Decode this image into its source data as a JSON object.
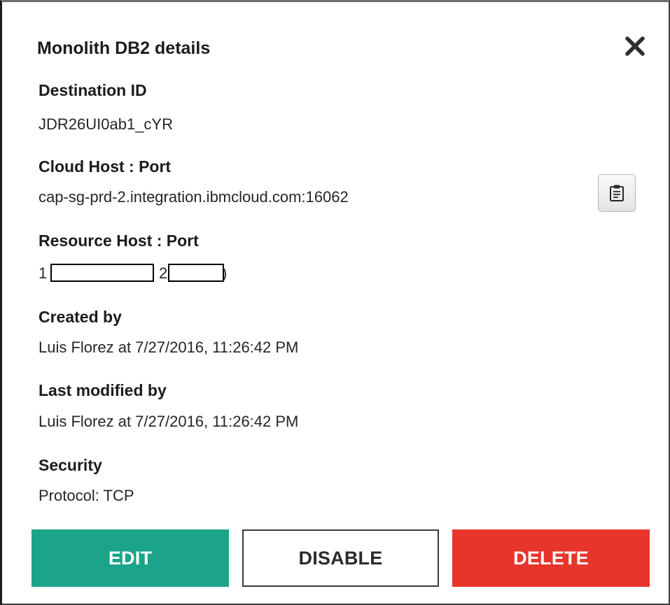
{
  "dialog": {
    "title": "Monolith DB2 details",
    "close_icon": "close-icon"
  },
  "sections": {
    "destination_id": {
      "label": "Destination ID",
      "value": "JDR26UI0ab1_cYR"
    },
    "cloud_host": {
      "label": "Cloud Host : Port",
      "value": "cap-sg-prd-2.integration.ibmcloud.com:16062",
      "copy_icon": "clipboard-icon"
    },
    "resource_host": {
      "label": "Resource Host : Port",
      "visible_fragments": [
        "1",
        "2",
        ")"
      ]
    },
    "created_by": {
      "label": "Created by",
      "value": "Luis Florez at 7/27/2016, 11:26:42 PM"
    },
    "last_modified_by": {
      "label": "Last modified by",
      "value": "Luis Florez at 7/27/2016, 11:26:42 PM"
    },
    "security": {
      "label": "Security",
      "value": "Protocol: TCP"
    }
  },
  "actions": {
    "edit_label": "EDIT",
    "disable_label": "DISABLE",
    "delete_label": "DELETE"
  },
  "colors": {
    "edit": "#1ba48a",
    "delete": "#e8352b",
    "text": "#1c1c1c"
  }
}
